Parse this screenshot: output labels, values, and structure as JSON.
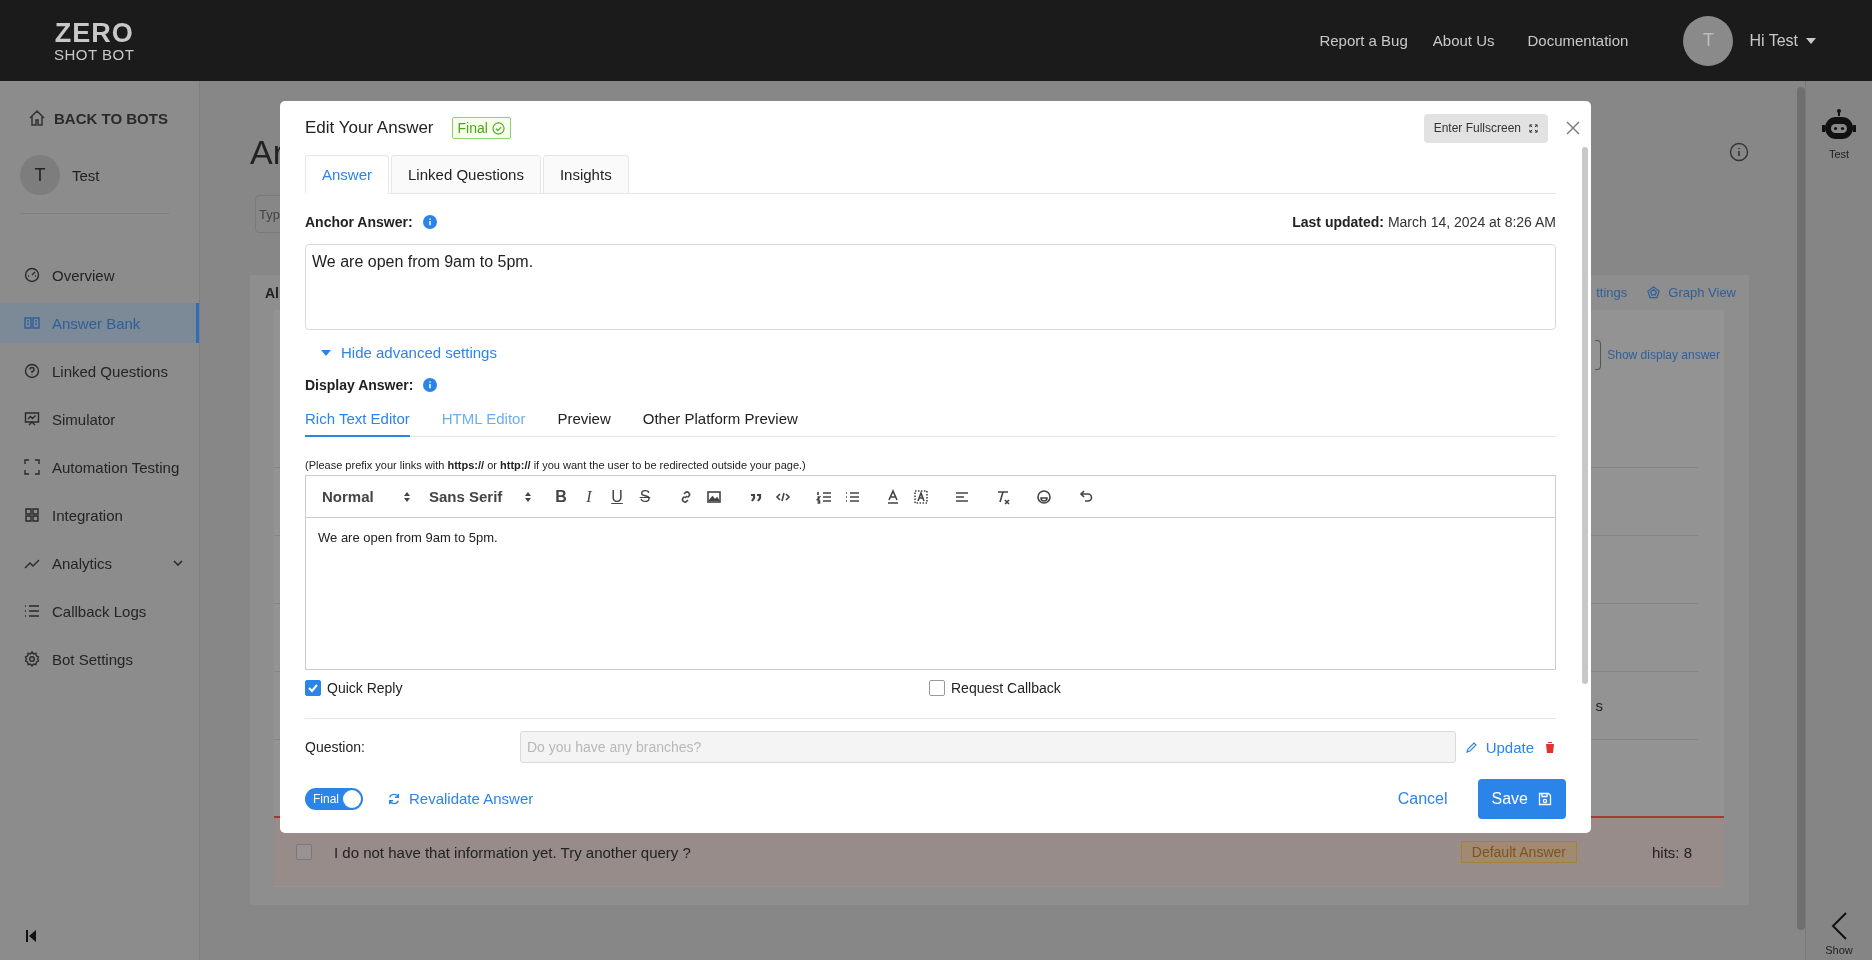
{
  "header": {
    "logo_top": "ZERO",
    "logo_bottom": "SHOT BOT",
    "nav": [
      "Report a Bug",
      "About Us",
      "Documentation"
    ],
    "avatar_initial": "T",
    "user": "Hi Test"
  },
  "sidebar": {
    "back": "BACK TO BOTS",
    "bot_initial": "T",
    "bot_name": "Test",
    "items": [
      {
        "label": "Overview",
        "kind": "gauge",
        "selected": false,
        "expandable": false
      },
      {
        "label": "Answer Bank",
        "kind": "book",
        "selected": true,
        "expandable": false
      },
      {
        "label": "Linked Questions",
        "kind": "question",
        "selected": false,
        "expandable": false
      },
      {
        "label": "Simulator",
        "kind": "screen",
        "selected": false,
        "expandable": false
      },
      {
        "label": "Automation Testing",
        "kind": "scan",
        "selected": false,
        "expandable": false
      },
      {
        "label": "Integration",
        "kind": "grid",
        "selected": false,
        "expandable": false
      },
      {
        "label": "Analytics",
        "kind": "trend",
        "selected": false,
        "expandable": true
      },
      {
        "label": "Callback Logs",
        "kind": "list",
        "selected": false,
        "expandable": false
      },
      {
        "label": "Bot Settings",
        "kind": "gear",
        "selected": false,
        "expandable": false
      }
    ]
  },
  "page": {
    "heading_part": "Ar",
    "search_placeholder_part": "Typ",
    "tab_part": "Al",
    "settings_part": "ttings",
    "graph_view": "Graph View",
    "show_display_answer": "Show display answer",
    "row_fragment": "s",
    "default_row": {
      "checked": false,
      "text": "I do not have that information yet. Try another query ?",
      "tag": "Default Answer",
      "hits": "hits: 8"
    }
  },
  "right_panel": {
    "bot_name": "Test",
    "show": "Show"
  },
  "modal": {
    "title": "Edit Your Answer",
    "status_tag": "Final",
    "fullscreen": "Enter Fullscreen",
    "tabs": [
      {
        "label": "Answer",
        "selected": true
      },
      {
        "label": "Linked Questions",
        "selected": false
      },
      {
        "label": "Insights",
        "selected": false
      }
    ],
    "anchor_label": "Anchor Answer:",
    "last_updated_label": "Last updated:",
    "last_updated": "March 14, 2024 at 8:26 AM",
    "anchor_answer": "We are open from 9am to 5pm.",
    "advanced_toggle": "Hide advanced settings",
    "advanced_expanded": true,
    "display_label": "Display Answer:",
    "editor_tabs": [
      {
        "label": "Rich Text Editor",
        "selected": true,
        "kind": "link"
      },
      {
        "label": "HTML Editor",
        "selected": false,
        "kind": "link"
      },
      {
        "label": "Preview",
        "selected": false,
        "kind": "plain"
      },
      {
        "label": "Other Platform Preview",
        "selected": false,
        "kind": "plain"
      }
    ],
    "note": "(Please prefix your links with **https://** or **http://** if you want the user to be redirected outside your page.)",
    "format_select": "Normal",
    "font_select": "Sans Serif",
    "tools": [
      [
        {
          "kind": "bold",
          "glyph": "B"
        },
        {
          "kind": "italic",
          "glyph": "I"
        },
        {
          "kind": "underline",
          "glyph": "U"
        },
        {
          "kind": "strike",
          "glyph": "S"
        }
      ],
      [
        {
          "kind": "link"
        },
        {
          "kind": "image"
        }
      ],
      [
        {
          "kind": "quote"
        },
        {
          "kind": "code"
        }
      ],
      [
        {
          "kind": "ordered"
        },
        {
          "kind": "bullet"
        }
      ],
      [
        {
          "kind": "color"
        },
        {
          "kind": "background"
        }
      ],
      [
        {
          "kind": "align"
        }
      ],
      [
        {
          "kind": "clean"
        }
      ],
      [
        {
          "kind": "emoji"
        }
      ],
      [
        {
          "kind": "undo"
        }
      ]
    ],
    "editor_text": "We are open from 9am to 5pm.",
    "options": [
      {
        "label": "Quick Reply",
        "checked": true
      },
      {
        "label": "Request Callback",
        "checked": false
      }
    ],
    "question_label": "Question:",
    "question_placeholder": "Do you have any branches?",
    "update": "Update",
    "final_toggle": {
      "label": "Final",
      "on": true
    },
    "revalidate": "Revalidate Answer",
    "cancel": "Cancel",
    "save": "Save"
  }
}
